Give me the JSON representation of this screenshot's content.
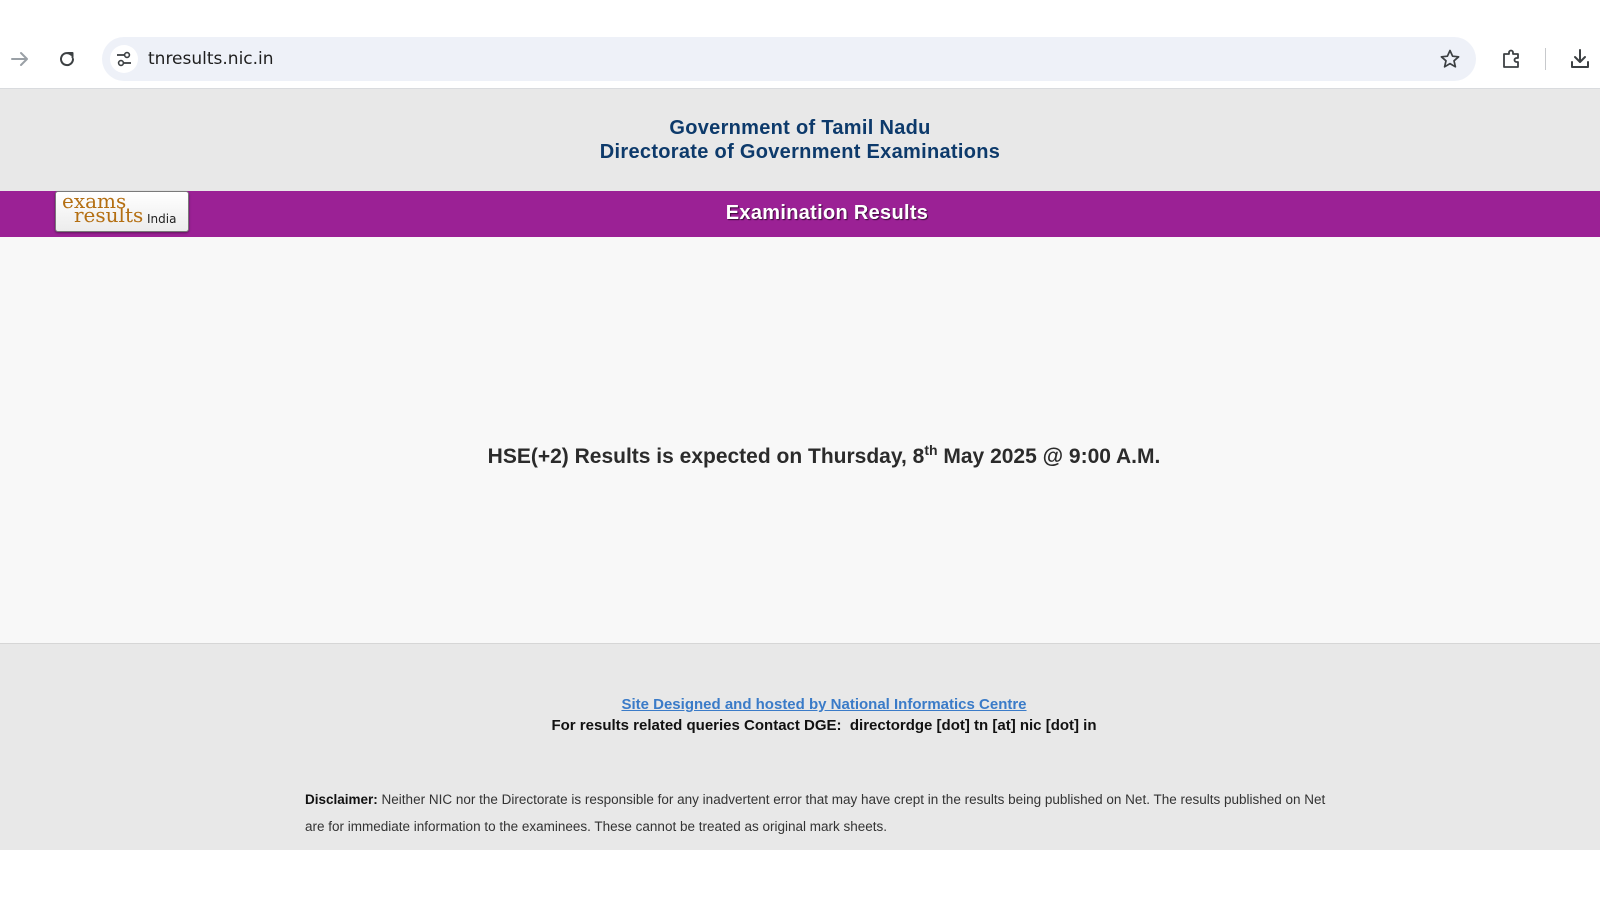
{
  "browser": {
    "url": "tnresults.nic.in"
  },
  "header": {
    "line1": "Government of Tamil Nadu",
    "line2": "Directorate of Government Examinations"
  },
  "banner": {
    "title": "Examination Results",
    "logo": {
      "word1": "exams",
      "word2": "results",
      "word3": "India"
    }
  },
  "announcement": {
    "before_sup": "HSE(+2) Results is expected on Thursday, 8",
    "sup": "th",
    "after_sup": " May 2025 @ 9:00 A.M."
  },
  "footer": {
    "link": "Site Designed and hosted by National Informatics Centre",
    "contact": "For results related queries Contact DGE:  directordge [dot] tn [at] nic [dot] in",
    "disclaimer_label": "Disclaimer:",
    "disclaimer_text": " Neither NIC nor the Directorate is responsible for any inadvertent error that may have crept in the results being published on Net. The results published on Net are for immediate information to the examinees. These cannot be treated as original mark sheets."
  },
  "colors": {
    "banner": "#9b2195",
    "header_text": "#0d3a6b",
    "link": "#3a7bc8"
  }
}
